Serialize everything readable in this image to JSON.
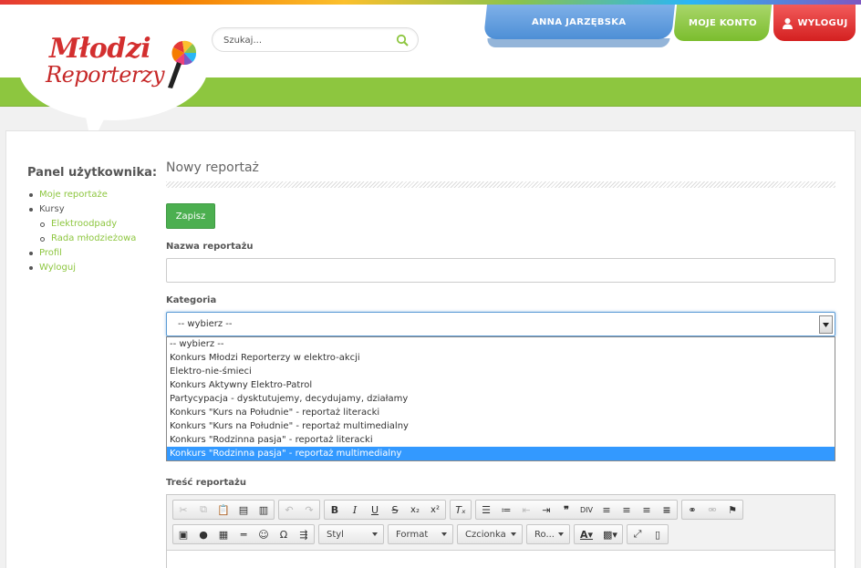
{
  "header": {
    "logo_line1": "Młodzi",
    "logo_line2": "Reporterzy",
    "search_placeholder": "Szukaj...",
    "tabs": {
      "user": "ANNA JARZĘBSKA",
      "account": "MOJE KONTO",
      "logout": "WYLOGUJ"
    }
  },
  "sidebar": {
    "title": "Panel użytkownika:",
    "items": [
      {
        "label": "Moje reportaże"
      },
      {
        "label": "Kursy"
      },
      {
        "label": "Elektroodpady"
      },
      {
        "label": "Rada młodzieżowa"
      },
      {
        "label": "Profil"
      },
      {
        "label": "Wyloguj"
      }
    ]
  },
  "main": {
    "title": "Nowy reportaż",
    "save_label": "Zapisz",
    "name_label": "Nazwa reportażu",
    "category_label": "Kategoria",
    "category_selected": "-- wybierz --",
    "category_options": [
      "-- wybierz --",
      "Konkurs Młodzi Reporterzy w elektro-akcji",
      "Elektro-nie-śmieci",
      "Konkurs Aktywny Elektro-Patrol",
      "Partycypacja - dysktutujemy, decydujamy, działamy",
      "Konkurs \"Kurs na Południe\" - reportaż literacki",
      "Konkurs \"Kurs na Południe\" - reportaż multimedialny",
      "Konkurs \"Rodzinna pasja\" - reportaż literacki",
      "Konkurs \"Rodzinna pasja\" - reportaż multimedialny"
    ],
    "content_label": "Treść reportażu",
    "editor": {
      "style": "Styl",
      "format": "Format",
      "font": "Czcionka",
      "size": "Ro..."
    }
  },
  "colors": {
    "green": "#8dc63f",
    "blue_tab": "#4d8fd6",
    "red_tab": "#d42020",
    "save": "#4caf50",
    "highlight": "#3399ff"
  }
}
